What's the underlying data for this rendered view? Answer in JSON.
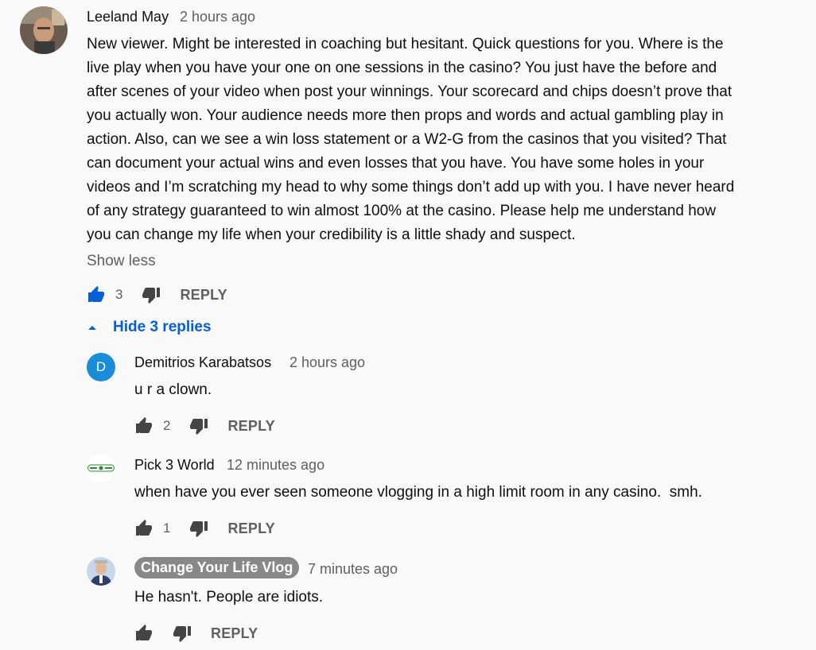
{
  "colors": {
    "accent": "#065fd4",
    "secondary_text": "#606060",
    "badge_bg": "#888888",
    "avatar_d": "#1a8cd8"
  },
  "main_comment": {
    "author": "Leeland May",
    "time": "2 hours ago",
    "lines": [
      "New viewer. Might be interested in coaching but hesitant. Quick questions for you. Where is the",
      "live play when you have your one on one sessions in the casino? You just have the before and",
      "after scenes of your video when post your winnings. Your scorecard and chips doesn’t prove that",
      "you actually won. Your audience needs more then props and words and actual gambling play in",
      "action. Also, can we see a win loss statement or a W2-G from the casinos that you visited? That",
      "can document your actual wins and even losses that you have. You have some holes in your",
      "videos and I’m scratching my head to why some things don’t add up with you. I have never heard",
      "of any strategy guaranteed to win almost 100% at the casino. Please help me understand how",
      "you can change my life when your credibility is a little shady and suspect."
    ],
    "show_less": "Show less",
    "likes": "3",
    "reply": "REPLY",
    "hide_replies": "Hide 3 replies"
  },
  "replies": [
    {
      "author": "Demitrios Karabatsos",
      "avatar_letter": "D",
      "time": "2 hours ago",
      "text": "u r a clown.",
      "likes": "2",
      "reply": "REPLY"
    },
    {
      "author": "Pick 3 World",
      "time": "12 minutes ago",
      "text": "when have you ever seen someone vlogging in a high limit room in any casino.  smh.",
      "likes": "1",
      "reply": "REPLY"
    },
    {
      "author": "Change Your Life Vlog",
      "time": "7 minutes ago",
      "text": "He hasn't. People are idiots.",
      "likes": "",
      "reply": "REPLY"
    }
  ]
}
